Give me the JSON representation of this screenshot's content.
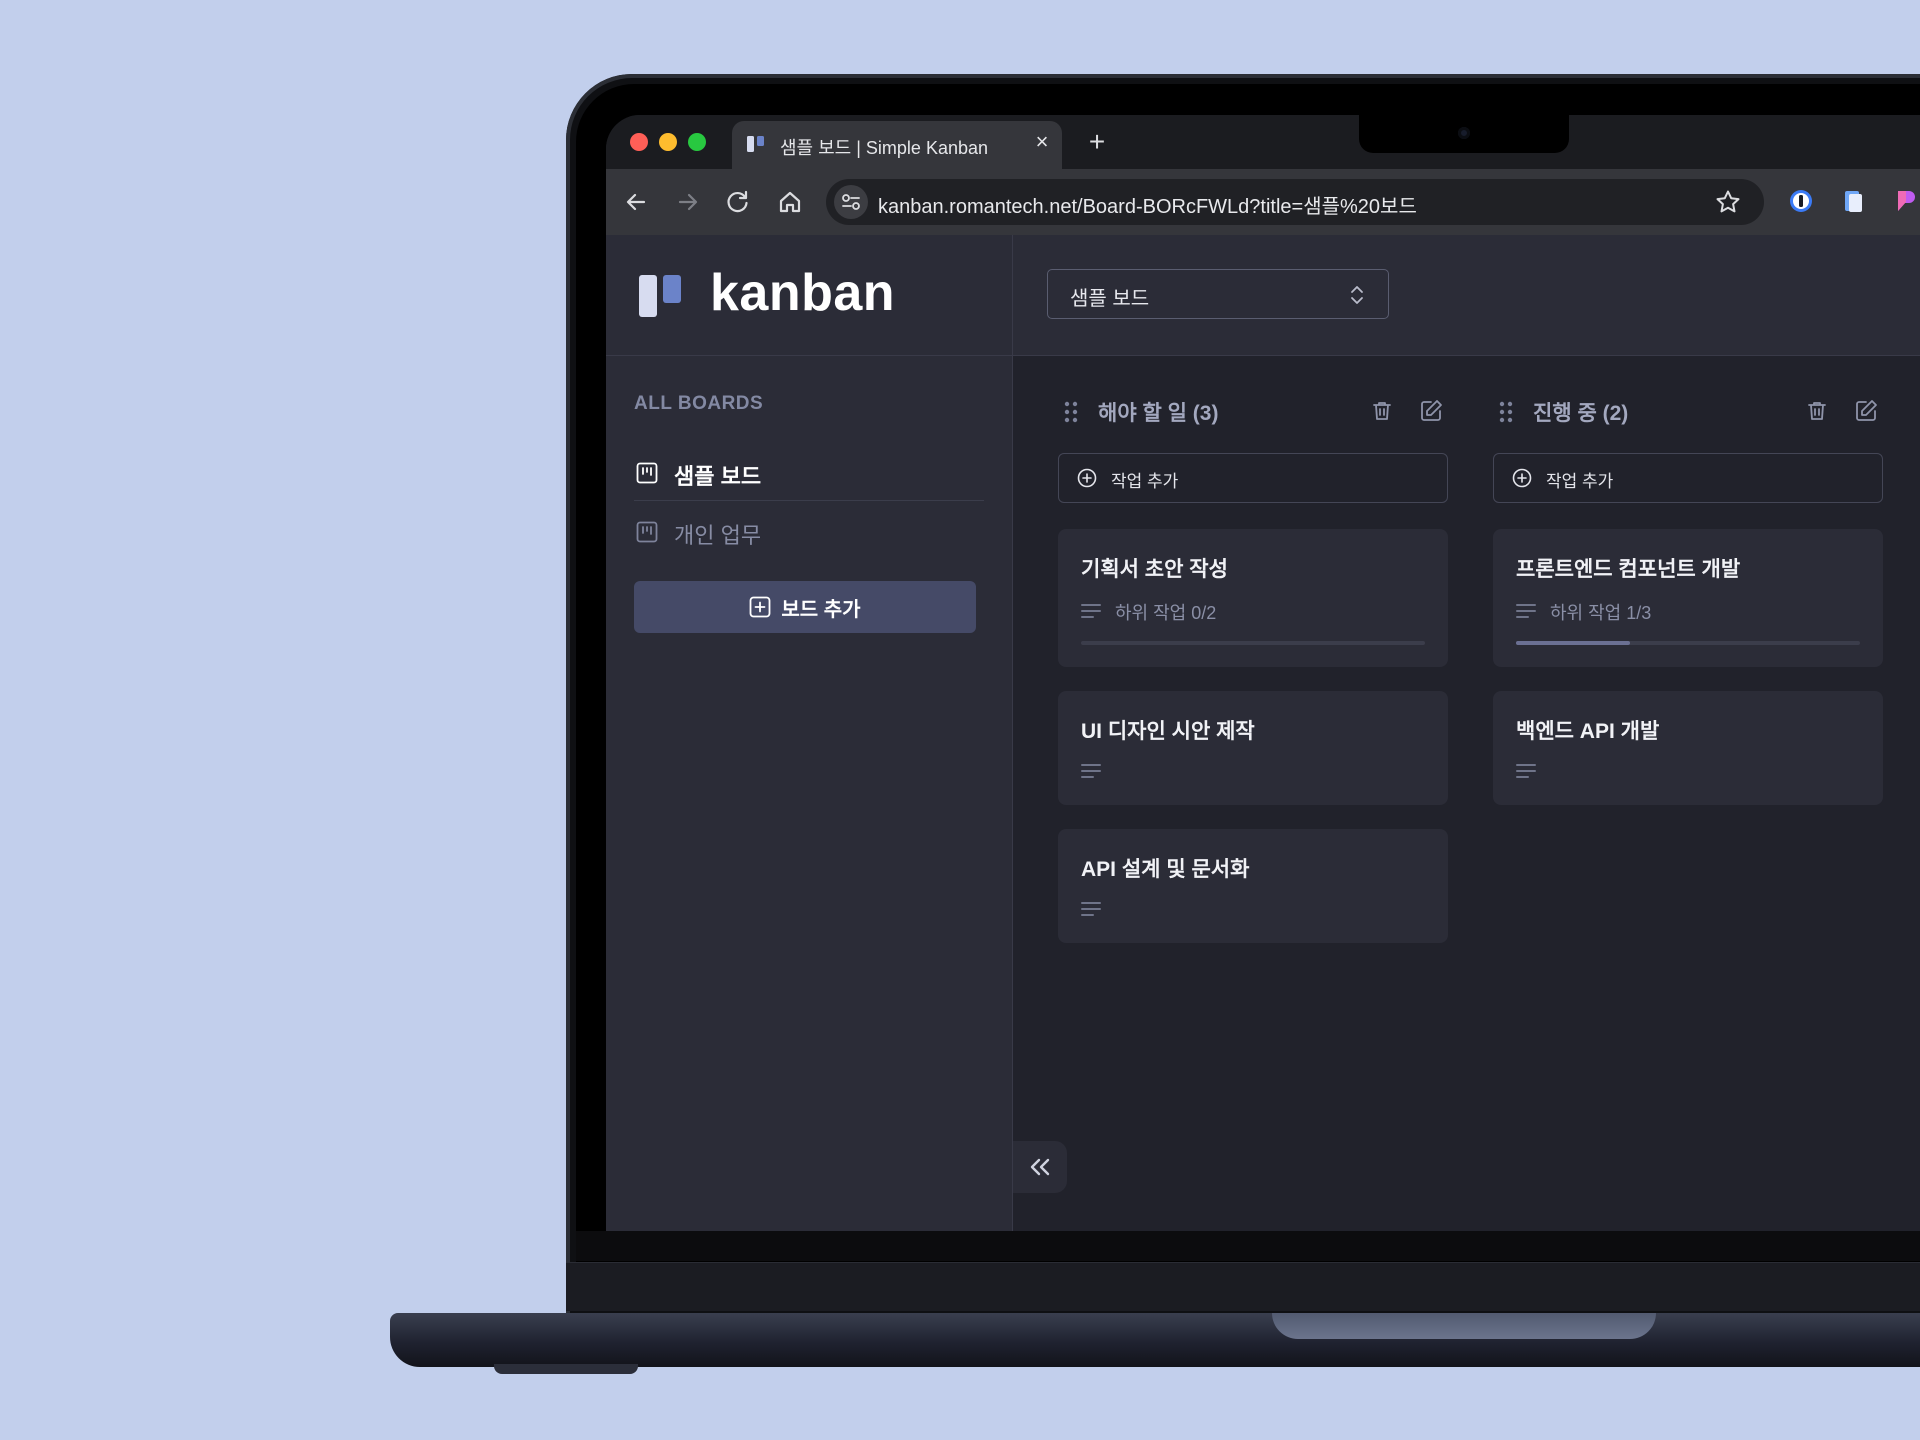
{
  "browser": {
    "tab_title": "샘플 보드 | Simple Kanban",
    "tab_close": "×",
    "new_tab": "+",
    "url": "kanban.romantech.net/Board-BORcFWLd?title=샘플%20보드"
  },
  "sidebar": {
    "brand": "kanban",
    "section_label": "ALL BOARDS",
    "boards": [
      {
        "label": "샘플 보드",
        "active": true
      },
      {
        "label": "개인 업무",
        "active": false
      }
    ],
    "add_board_label": "보드 추가"
  },
  "header": {
    "board_select_value": "샘플 보드"
  },
  "columns": [
    {
      "title": "해야 할 일 (3)",
      "add_task_label": "작업 추가",
      "cards": [
        {
          "title": "기획서 초안 작성",
          "subtasks": "하위 작업 0/2",
          "progress": 0
        },
        {
          "title": "UI 디자인 시안 제작",
          "subtasks": "",
          "progress": null
        },
        {
          "title": "API 설계 및 문서화",
          "subtasks": "",
          "progress": null
        }
      ]
    },
    {
      "title": "진행 중 (2)",
      "add_task_label": "작업 추가",
      "cards": [
        {
          "title": "프론트엔드 컴포넌트 개발",
          "subtasks": "하위 작업 1/3",
          "progress": 0.33
        },
        {
          "title": "백엔드 API 개발",
          "subtasks": "",
          "progress": null
        }
      ]
    }
  ],
  "colors": {
    "background": "#c2cfec",
    "sidebar": "#2b2c37",
    "main": "#21222b",
    "accent": "#6b83c9",
    "button": "#454a67"
  }
}
